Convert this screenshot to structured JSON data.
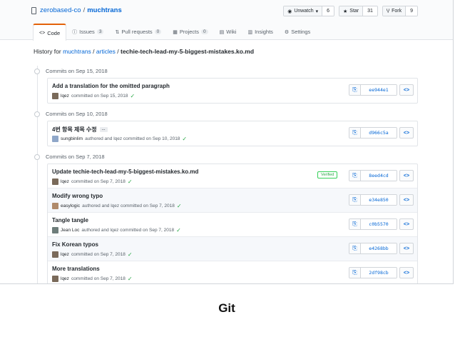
{
  "repo": {
    "owner": "zerobased-co",
    "separator": "/",
    "name": "muchtrans"
  },
  "actions": [
    {
      "label": "Unwatch",
      "caret": "▾",
      "count": "6",
      "icon": "eye-icon",
      "glyph": "◉"
    },
    {
      "label": "Star",
      "caret": "",
      "count": "31",
      "icon": "star-icon",
      "glyph": "★"
    },
    {
      "label": "Fork",
      "caret": "",
      "count": "9",
      "icon": "fork-icon",
      "glyph": "Ⴤ"
    }
  ],
  "tabs": [
    {
      "label": "Code",
      "badge": "",
      "glyph": "<>",
      "icon": "code-icon"
    },
    {
      "label": "Issues",
      "badge": "3",
      "glyph": "ⓘ",
      "icon": "issue-icon"
    },
    {
      "label": "Pull requests",
      "badge": "0",
      "glyph": "⇅",
      "icon": "pull-request-icon"
    },
    {
      "label": "Projects",
      "badge": "0",
      "glyph": "▦",
      "icon": "project-icon"
    },
    {
      "label": "Wiki",
      "badge": "",
      "glyph": "▤",
      "icon": "wiki-icon"
    },
    {
      "label": "Insights",
      "badge": "",
      "glyph": "▥",
      "icon": "insights-icon"
    },
    {
      "label": "Settings",
      "badge": "",
      "glyph": "⚙",
      "icon": "gear-icon"
    }
  ],
  "history": {
    "prefix": "History for",
    "repo": "muchtrans",
    "sep": "/",
    "folder": "articles",
    "sep2": "/",
    "file": "techie-tech-lead-my-5-biggest-mistakes.ko.md"
  },
  "days": [
    {
      "label": "Commits on Sep 15, 2018",
      "commits": [
        {
          "message": "Add a translation for the omitted paragraph",
          "more": "",
          "author": "lqez",
          "coauthor": "",
          "meta": "committed on Sep 15, 2018",
          "verified": "",
          "sha": "ee944e1"
        }
      ]
    },
    {
      "label": "Commits on Sep 10, 2018",
      "commits": [
        {
          "message": "4번 항목 제목 수정",
          "more": "…",
          "author": "sungbinlim",
          "coauthor": "lqez",
          "meta": "authored and lqez committed on Sep 10, 2018",
          "verified": "",
          "sha": "d966c5a"
        }
      ]
    },
    {
      "label": "Commits on Sep 7, 2018",
      "commits": [
        {
          "message": "Update techie-tech-lead-my-5-biggest-mistakes.ko.md",
          "more": "",
          "author": "lqez",
          "coauthor": "",
          "meta": "committed on Sep 7, 2018",
          "verified": "Verified",
          "sha": "8eed4cd"
        },
        {
          "message": "Modify wrong typo",
          "more": "",
          "author": "easylogic",
          "coauthor": "lqez",
          "meta": "authored and lqez committed on Sep 7, 2018",
          "verified": "",
          "sha": "e34e850"
        },
        {
          "message": "Tangle tangle",
          "more": "",
          "author": "Jean Loc",
          "coauthor": "lqez",
          "meta": "authored and lqez committed on Sep 7, 2018",
          "verified": "",
          "sha": "c0b5570"
        },
        {
          "message": "Fix Korean typos",
          "more": "",
          "author": "lqez",
          "coauthor": "",
          "meta": "committed on Sep 7, 2018",
          "verified": "",
          "sha": "e4268bb"
        },
        {
          "message": "More translations",
          "more": "",
          "author": "lqez",
          "coauthor": "",
          "meta": "committed on Sep 7, 2018",
          "verified": "",
          "sha": "2df98cb"
        }
      ]
    }
  ],
  "caption": "Git"
}
